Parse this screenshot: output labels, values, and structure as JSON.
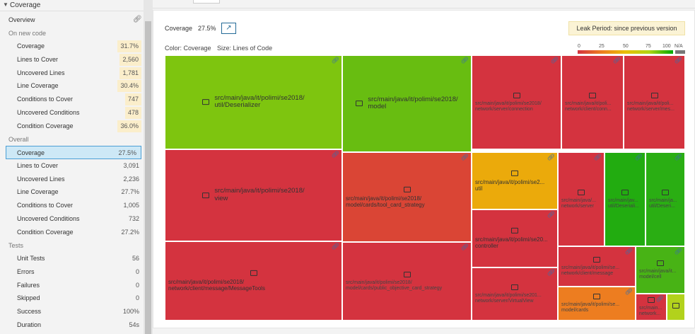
{
  "sidebar": {
    "title": "Coverage",
    "overview_label": "Overview",
    "section_new": "On new code",
    "new_code": [
      {
        "label": "Coverage",
        "value": "31.7%"
      },
      {
        "label": "Lines to Cover",
        "value": "2,560"
      },
      {
        "label": "Uncovered Lines",
        "value": "1,781"
      },
      {
        "label": "Line Coverage",
        "value": "30.4%"
      },
      {
        "label": "Conditions to Cover",
        "value": "747"
      },
      {
        "label": "Uncovered Conditions",
        "value": "478"
      },
      {
        "label": "Condition Coverage",
        "value": "36.0%"
      }
    ],
    "section_overall": "Overall",
    "overall": [
      {
        "label": "Coverage",
        "value": "27.5%"
      },
      {
        "label": "Lines to Cover",
        "value": "3,091"
      },
      {
        "label": "Uncovered Lines",
        "value": "2,236"
      },
      {
        "label": "Line Coverage",
        "value": "27.7%"
      },
      {
        "label": "Conditions to Cover",
        "value": "1,005"
      },
      {
        "label": "Uncovered Conditions",
        "value": "732"
      },
      {
        "label": "Condition Coverage",
        "value": "27.2%"
      }
    ],
    "section_tests": "Tests",
    "tests": [
      {
        "label": "Unit Tests",
        "value": "56"
      },
      {
        "label": "Errors",
        "value": "0"
      },
      {
        "label": "Failures",
        "value": "0"
      },
      {
        "label": "Skipped",
        "value": "0"
      },
      {
        "label": "Success",
        "value": "100%"
      },
      {
        "label": "Duration",
        "value": "54s"
      }
    ]
  },
  "main": {
    "coverage_label": "Coverage",
    "coverage_value": "27.5%",
    "leak_period": "Leak Period: since previous version",
    "color_label": "Color: Coverage",
    "size_label": "Size: Lines of Code",
    "legend_ticks": [
      "0",
      "25",
      "50",
      "75",
      "100"
    ],
    "legend_na": "N/A"
  },
  "treemap": [
    {
      "name": "src/main/java/it/polimi/se2018/\nutil/Deserializer",
      "color": "#7ec50f",
      "size": "big"
    },
    {
      "name": "src/main/java/it/polimi/se2018/\nmodel",
      "color": "#68bd11",
      "size": "big"
    },
    {
      "name": "src/main/java/it/polimi/se2018/\nnetwork/server/connection",
      "color": "#d4333f",
      "size": "sm"
    },
    {
      "name": "src/main/java/it/poli...\nnetwork/client/conn...",
      "color": "#d4333f",
      "size": "sm"
    },
    {
      "name": "src/main/java/it/poli...\nnetwork/server/mes...",
      "color": "#d4333f",
      "size": "sm"
    },
    {
      "name": "src/main/java/it/polimi/se2018/\nview",
      "color": "#d4333f",
      "size": "big"
    },
    {
      "name": "src/main/java/it/polimi/se2018/\nmodel/cards/tool_card_strategy",
      "color": "#da4535",
      "size": "med"
    },
    {
      "name": "src/main/java/it/polimi/se2...\nutil",
      "color": "#ebaa0b",
      "size": "med"
    },
    {
      "name": "src/main/java/...\nnetwork/server",
      "color": "#d4333f",
      "size": "sm"
    },
    {
      "name": "src/main/jav...\nutil/Deseriali...",
      "color": "#22ac10",
      "size": "sm"
    },
    {
      "name": "src/main/ja...\nutil/Deseri...",
      "color": "#2aae13",
      "size": "sm"
    },
    {
      "name": "src/main/java/it/polimi/se20...\ncontroller",
      "color": "#d4333f",
      "size": "med"
    },
    {
      "name": "src/main/java/it/polimi/se2018/\nnetwork/client/message/MessageTools",
      "color": "#d4333f",
      "size": "med"
    },
    {
      "name": "src/main/java/it/polimi/se2018/\nmodel/cards/public_objective_card_strategy",
      "color": "#d4333f",
      "size": "sm"
    },
    {
      "name": "src/main/java/it/polimi/se...\nnetwork/client/message",
      "color": "#d4333f",
      "size": "sm"
    },
    {
      "name": "src/main/java/it...\nmodel/cell",
      "color": "#48b315",
      "size": "sm"
    },
    {
      "name": "src/main/java/it/polimi/se201...\nnetwork/server/VirtualView",
      "color": "#d4333f",
      "size": "sm"
    },
    {
      "name": "src/main/java/it/polimi/se...\nmodel/cards",
      "color": "#ed7d20",
      "size": "sm"
    },
    {
      "name": "src/main...\nnetwork...",
      "color": "#d4333f",
      "size": "sm"
    },
    {
      "name": "",
      "color": "#b2d21c",
      "size": "sm"
    }
  ]
}
